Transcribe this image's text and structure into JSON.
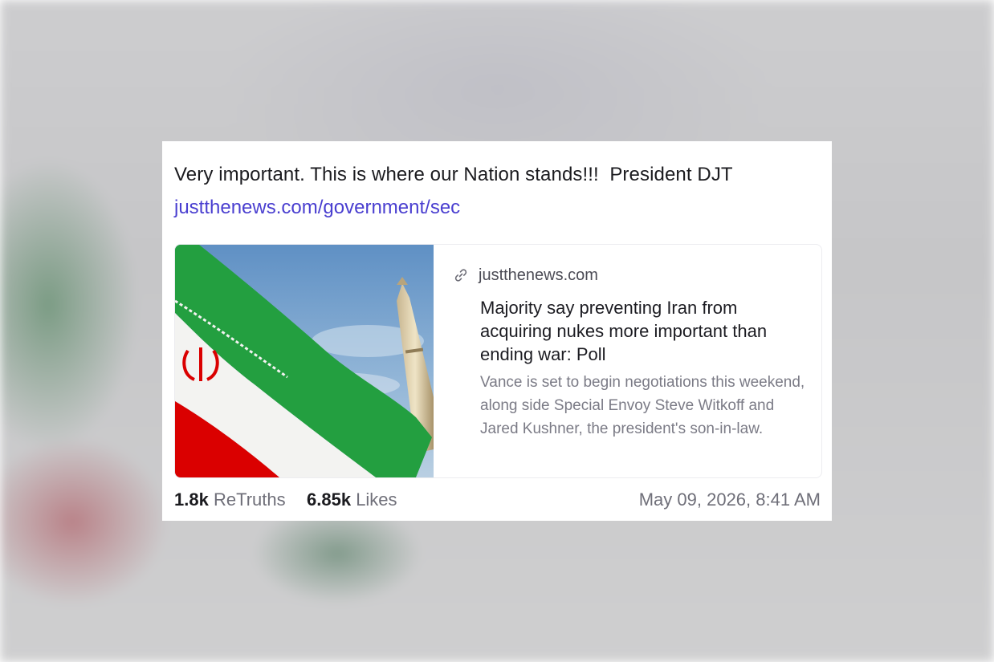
{
  "post": {
    "text": "Very important. This is where our Nation stands!!!  President DJT",
    "link": "justthenews.com/government/sec"
  },
  "link_preview": {
    "domain": "justthenews.com",
    "headline": "Majority say preventing Iran from acquiring nukes more important than ending war: Poll",
    "summary": "Vance is set to begin negotiations this weekend, along side Special Envoy Steve Witkoff and Jared Kushner, the president's son-in-law.",
    "image_icon": "iran-flag-and-missile-photo",
    "link_icon": "chain-link-icon"
  },
  "stats": {
    "retruths_count": "1.8k",
    "retruths_label": "ReTruths",
    "likes_count": "6.85k",
    "likes_label": "Likes",
    "timestamp": "May 09, 2026, 8:41 AM"
  },
  "colors": {
    "link": "#4a3fd0",
    "text": "#1b1b1f",
    "muted": "#7b7b86",
    "flag_green": "#239f40",
    "flag_red": "#da0000"
  }
}
